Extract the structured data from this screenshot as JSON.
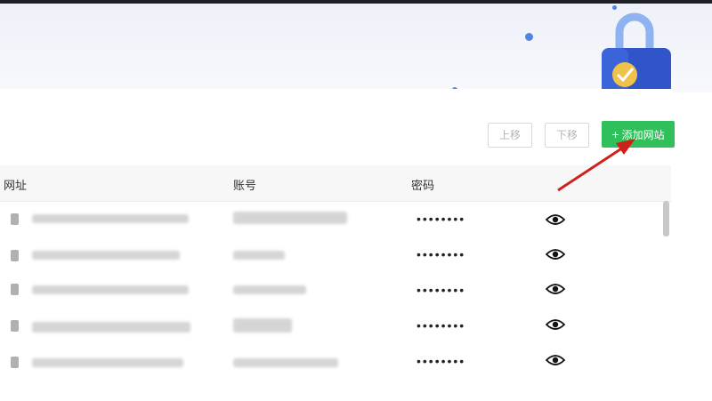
{
  "toolbar": {
    "move_up_label": "上移",
    "move_down_label": "下移",
    "add_site_label": "添加网站"
  },
  "table": {
    "columns": [
      "网址",
      "账号",
      "密码"
    ],
    "rows": [
      {
        "password": "••••••••"
      },
      {
        "password": "••••••••"
      },
      {
        "password": "••••••••"
      },
      {
        "password": "••••••••"
      },
      {
        "password": "••••••••"
      }
    ]
  },
  "colors": {
    "accent_green": "#2fbf5b",
    "annotation_arrow": "#d0201a",
    "dot_blue": "#4f86e0"
  },
  "icons": [
    "lock-illustration",
    "plus-icon",
    "eye-icon"
  ]
}
